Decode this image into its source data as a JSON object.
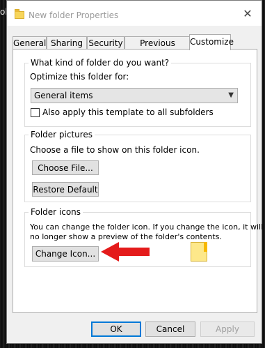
{
  "background": {
    "edge_text": "olc"
  },
  "window": {
    "title": "New folder Properties",
    "close_glyph": "✕"
  },
  "tabs": [
    {
      "label": "General"
    },
    {
      "label": "Sharing"
    },
    {
      "label": "Security"
    },
    {
      "label": "Previous Versions"
    },
    {
      "label": "Customize",
      "active": true
    }
  ],
  "folder_type": {
    "title": "What kind of folder do you want?",
    "optimize_label": "Optimize this folder for:",
    "selected": "General items",
    "apply_subfolders_label": "Also apply this template to all subfolders",
    "apply_subfolders_checked": false
  },
  "folder_pictures": {
    "title": "Folder pictures",
    "description": "Choose a file to show on this folder icon.",
    "choose_file_label": "Choose File...",
    "restore_default_label": "Restore Default"
  },
  "folder_icons": {
    "title": "Folder icons",
    "description_line1": "You can change the folder icon. If you change the icon, it will",
    "description_line2": "no longer show a preview of the folder's contents.",
    "change_icon_label": "Change Icon..."
  },
  "footer": {
    "ok_label": "OK",
    "cancel_label": "Cancel",
    "apply_label": "Apply"
  },
  "annotation": {
    "arrow_color": "#e41b1b"
  }
}
